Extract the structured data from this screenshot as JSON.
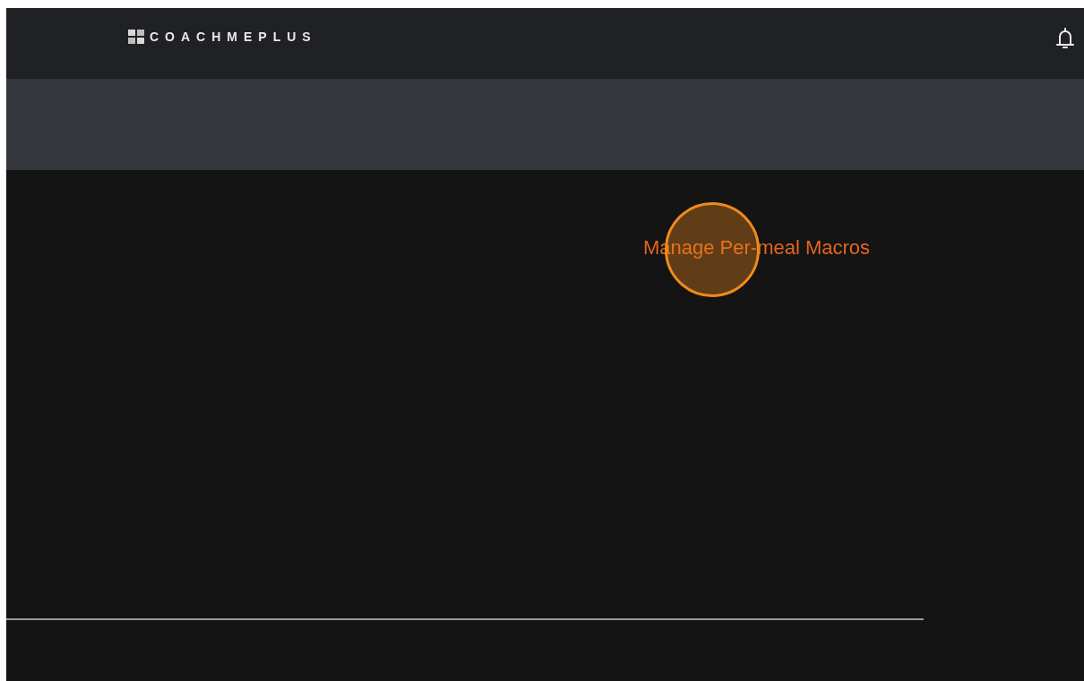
{
  "header": {
    "logo_text": "COACHMEPLUS"
  },
  "main": {
    "link": "Manage Per-meal Macros"
  },
  "touch_indicator": {
    "shown": true
  }
}
